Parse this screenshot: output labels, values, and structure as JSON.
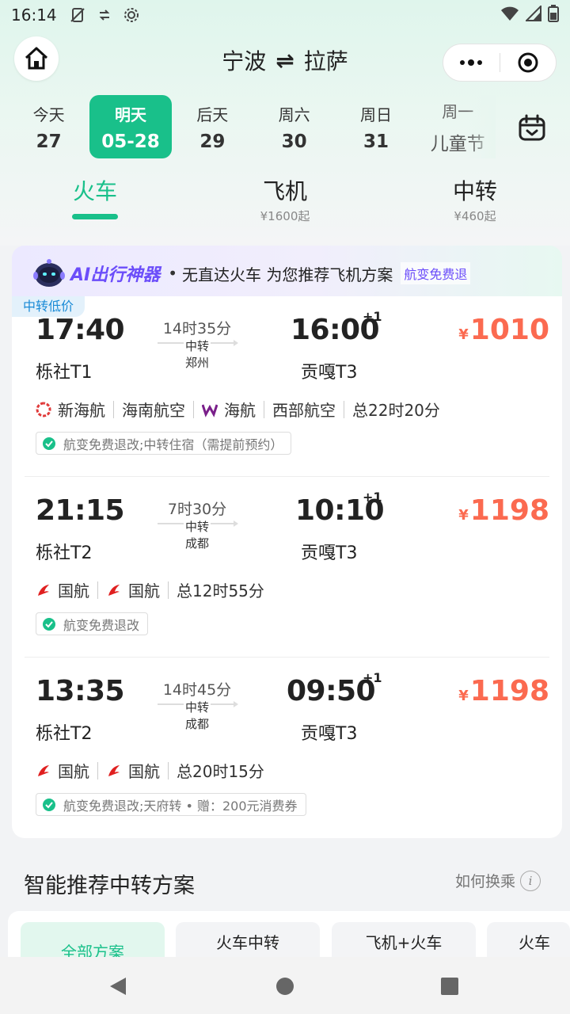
{
  "status": {
    "time": "16:14"
  },
  "header": {
    "from": "宁波",
    "swap_symbol": "⇌",
    "to": "拉萨"
  },
  "dates": [
    {
      "weekday": "今天",
      "day": "27"
    },
    {
      "weekday": "明天",
      "day": "05-28"
    },
    {
      "weekday": "后天",
      "day": "29"
    },
    {
      "weekday": "周六",
      "day": "30"
    },
    {
      "weekday": "周日",
      "day": "31"
    },
    {
      "weekday": "周一",
      "day": "儿童节"
    }
  ],
  "modes": [
    {
      "label": "火车",
      "sub": ""
    },
    {
      "label": "飞机",
      "sub": "¥1600起"
    },
    {
      "label": "中转",
      "sub": "¥460起"
    }
  ],
  "ai_banner": {
    "title": "AI出行神器",
    "dot": "•",
    "text": "无直达火车 为您推荐飞机方案",
    "tag": "航变免费退"
  },
  "low_price_tag": "中转低价",
  "flights": [
    {
      "dep_time": "17:40",
      "arr_time": "16:00",
      "plus": "+1",
      "duration": "14时35分",
      "transfer_label": "中转",
      "transfer_city": "郑州",
      "dep_airport": "栎社T1",
      "arr_airport": "贡嘎T3",
      "currency": "¥",
      "price": "1010",
      "airlines": [
        "新海航",
        "海南航空",
        "海航",
        "西部航空"
      ],
      "total": "总22时20分",
      "policy": "航变免费退改;中转住宿（需提前预约）"
    },
    {
      "dep_time": "21:15",
      "arr_time": "10:10",
      "plus": "+1",
      "duration": "7时30分",
      "transfer_label": "中转",
      "transfer_city": "成都",
      "dep_airport": "栎社T2",
      "arr_airport": "贡嘎T3",
      "currency": "¥",
      "price": "1198",
      "airlines": [
        "国航",
        "国航"
      ],
      "total": "总12时55分",
      "policy": "航变免费退改"
    },
    {
      "dep_time": "13:35",
      "arr_time": "09:50",
      "plus": "+1",
      "duration": "14时45分",
      "transfer_label": "中转",
      "transfer_city": "成都",
      "dep_airport": "栎社T2",
      "arr_airport": "贡嘎T3",
      "currency": "¥",
      "price": "1198",
      "airlines": [
        "国航",
        "国航"
      ],
      "total": "总20时15分",
      "policy": "航变免费退改;天府转 • 赠：200元消费券"
    }
  ],
  "smart": {
    "title": "智能推荐中转方案",
    "how": "如何换乘",
    "info_symbol": "i",
    "tabs": [
      "全部方案",
      "火车中转",
      "飞机+火车",
      "火车"
    ]
  },
  "colors": {
    "accent": "#19c08a",
    "price": "#fb6a50",
    "ai_purple": "#6b4dfa"
  }
}
